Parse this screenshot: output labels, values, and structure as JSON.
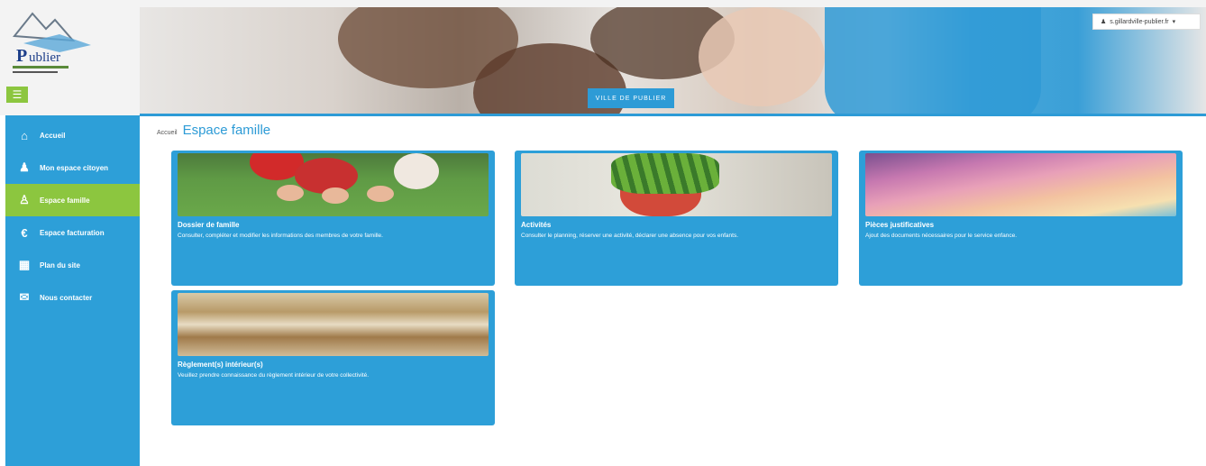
{
  "header": {
    "logo_text": "Publier",
    "city_button": "VILLE DE PUBLIER",
    "user_label": "s.gillardville-publier.fr"
  },
  "sidebar": {
    "items": [
      {
        "label": "Accueil",
        "icon": "home-icon",
        "active": false
      },
      {
        "label": "Mon espace citoyen",
        "icon": "user-icon",
        "active": false
      },
      {
        "label": "Espace famille",
        "icon": "family-icon",
        "active": true
      },
      {
        "label": "Espace facturation",
        "icon": "euro-icon",
        "active": false
      },
      {
        "label": "Plan du site",
        "icon": "sitemap-icon",
        "active": false
      },
      {
        "label": "Nous contacter",
        "icon": "mail-icon",
        "active": false
      }
    ]
  },
  "breadcrumb": {
    "home": "Accueil",
    "title": "Espace famille"
  },
  "cards": [
    {
      "title": "Dossier de famille",
      "desc": "Consulter, compléter et modifier les informations des membres de votre famille."
    },
    {
      "title": "Activités",
      "desc": "Consulter le planning, réserver une activité, déclarer une absence pour vos enfants."
    },
    {
      "title": "Pièces justificatives",
      "desc": "Ajout des documents nécessaires pour le service enfance."
    },
    {
      "title": "Règlement(s) intérieur(s)",
      "desc": "Veuillez prendre connaissance du règlement intérieur de votre collectivité."
    }
  ],
  "colors": {
    "primary": "#2d9fd8",
    "accent": "#8cc63f"
  }
}
